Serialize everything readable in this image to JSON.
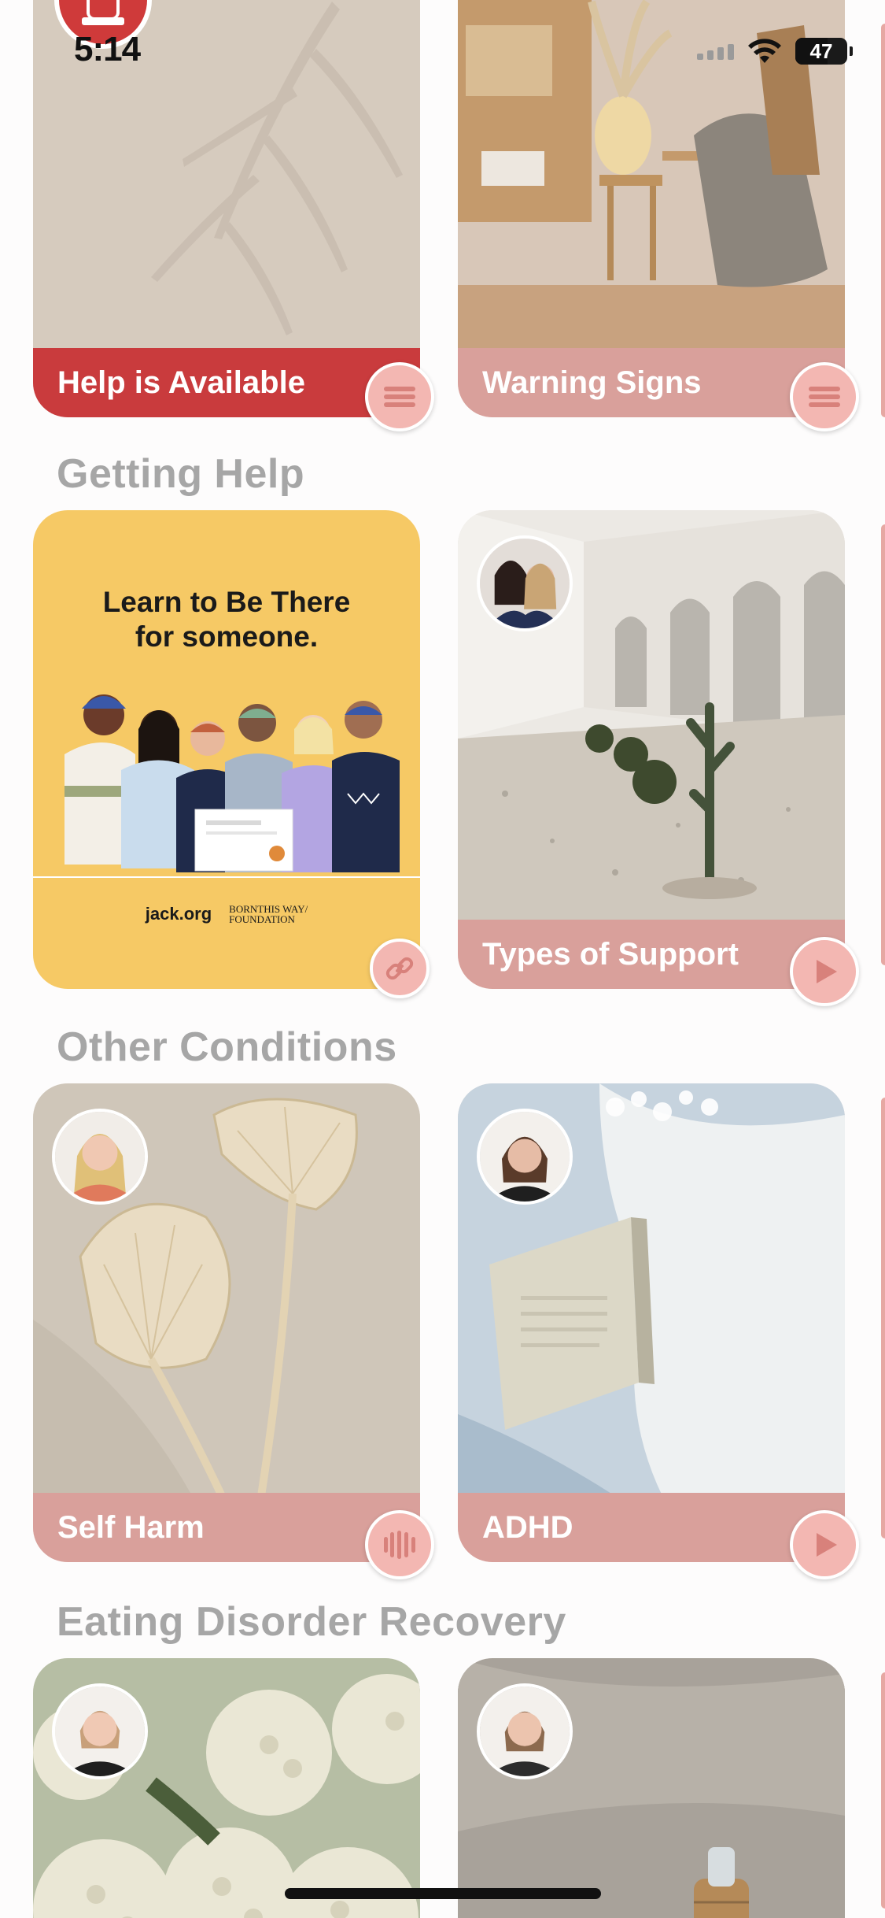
{
  "status_bar": {
    "time": "5:14",
    "battery": "47"
  },
  "sections": [
    {
      "title": "Getting Help"
    },
    {
      "title": "Other Conditions"
    },
    {
      "title": "Eating Disorder Recovery"
    }
  ],
  "cards": {
    "help_available": {
      "label": "Help is Available",
      "badge_icon": "list-icon",
      "label_color": "#c93b3d"
    },
    "warning_signs": {
      "label": "Warning Signs",
      "badge_icon": "list-icon"
    },
    "learn_be_there": {
      "headline_line1": "Learn to Be There",
      "headline_line2": "for someone.",
      "footer_org": "jack.org",
      "footer_partner_line1": "BORNTHIS WAY/",
      "footer_partner_line2": "FOUNDATION",
      "badge_icon": "link-icon"
    },
    "types_of_support": {
      "label": "Types of Support",
      "badge_icon": "play-icon"
    },
    "self_harm": {
      "label": "Self Harm",
      "badge_icon": "audio-wave-icon"
    },
    "adhd": {
      "label": "ADHD",
      "badge_icon": "play-icon"
    }
  },
  "colors": {
    "card_label": "#d9a09b",
    "card_label_alert": "#c93b3d",
    "badge": "#f3b7b2",
    "section_title": "#a6a6a6",
    "yellow_card": "#f6c965"
  }
}
